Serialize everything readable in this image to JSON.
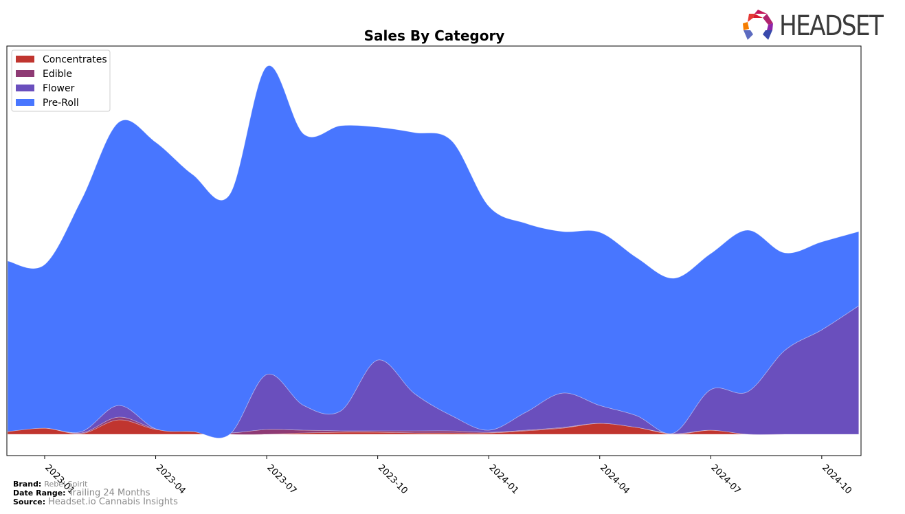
{
  "logo": {
    "text": "HEADSET"
  },
  "footer": {
    "brand_label": "Brand:",
    "brand_value": "Rebel Spirit",
    "range_label": "Date Range:",
    "range_value": "Trailing 24 Months",
    "source_label": "Source:",
    "source_value": "Headset.io Cannabis Insights"
  },
  "colors": {
    "Concentrates": "#c0352f",
    "Edible": "#8e3a74",
    "Flower": "#6a4fbd",
    "Pre-Roll": "#4876ff"
  },
  "chart_data": {
    "type": "area",
    "stacked": true,
    "title": "Sales By Category",
    "xlabel": "",
    "ylabel": "",
    "y_tick_labels_shown": false,
    "ylim": [
      -31,
      565
    ],
    "x": [
      "2022-12",
      "2023-01",
      "2023-02",
      "2023-03",
      "2023-04",
      "2023-05",
      "2023-06",
      "2023-07",
      "2023-08",
      "2023-09",
      "2023-10",
      "2023-11",
      "2023-12",
      "2024-01",
      "2024-02",
      "2024-03",
      "2024-04",
      "2024-05",
      "2024-06",
      "2024-07",
      "2024-08",
      "2024-09",
      "2024-10",
      "2024-11"
    ],
    "x_ticks": [
      "2023-01",
      "2023-04",
      "2023-07",
      "2023-10",
      "2024-01",
      "2024-04",
      "2024-07",
      "2024-10"
    ],
    "legend": {
      "placement": "top-left",
      "entries": [
        "Concentrates",
        "Edible",
        "Flower",
        "Pre-Roll"
      ]
    },
    "series": [
      {
        "name": "Concentrates",
        "values": [
          5,
          9,
          1,
          21,
          7,
          4,
          0,
          0,
          2,
          3,
          3,
          2,
          2,
          2,
          5,
          9,
          16,
          10,
          0,
          6,
          0,
          0,
          0,
          0
        ]
      },
      {
        "name": "Edible",
        "values": [
          1,
          1,
          1,
          4,
          1,
          1,
          2,
          7,
          4,
          2,
          2,
          3,
          3,
          1,
          1,
          1,
          0,
          0,
          1,
          0,
          0,
          0,
          0,
          0
        ]
      },
      {
        "name": "Flower",
        "values": [
          -2,
          -1,
          2,
          17,
          0,
          -1,
          -2,
          80,
          36,
          29,
          103,
          54,
          22,
          3,
          26,
          50,
          26,
          17,
          1,
          59,
          62,
          122,
          152,
          187
        ]
      },
      {
        "name": "Pre-Roll",
        "values": [
          248,
          238,
          338,
          412,
          417,
          374,
          349,
          448,
          395,
          415,
          339,
          380,
          400,
          326,
          275,
          235,
          252,
          230,
          225,
          198,
          235,
          142,
          128,
          108
        ]
      }
    ]
  }
}
